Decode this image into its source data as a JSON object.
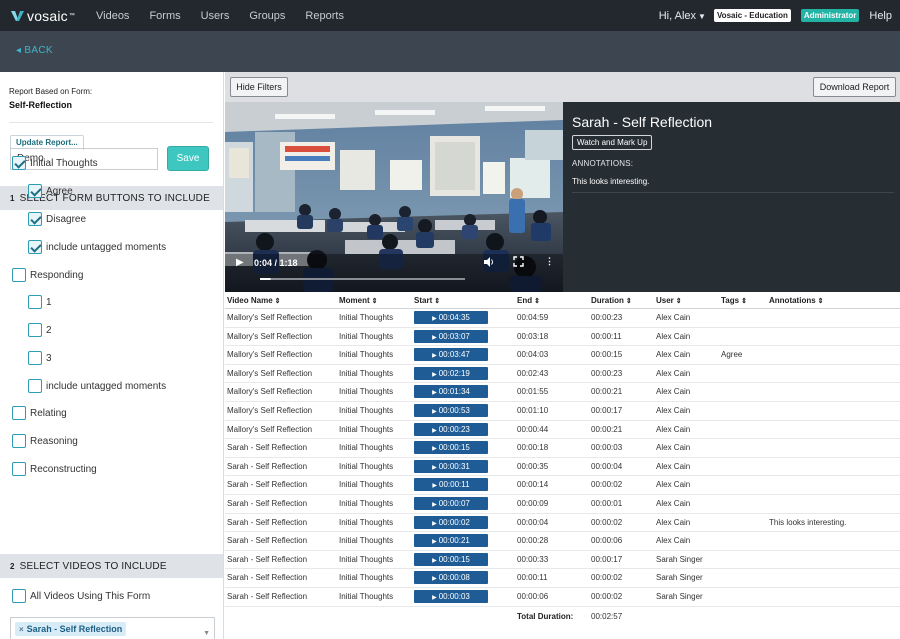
{
  "topnav": {
    "logo_text": "vosaic",
    "logo_tm": "™",
    "items": [
      "Videos",
      "Forms",
      "Users",
      "Groups",
      "Reports"
    ],
    "greeting": "Hi, Alex",
    "org_badge": "Vosaic - Education",
    "role_badge": "Administrator",
    "help": "Help"
  },
  "back_label": "BACK",
  "sidebar": {
    "report_based_label": "Report Based on Form:",
    "form_name": "Self-Reflection",
    "update_label": "Update Report...",
    "report_name_value": "Demo",
    "save_label": "Save",
    "section1": {
      "num": "1",
      "title": "SELECT FORM BUTTONS TO INCLUDE"
    },
    "buttons": [
      {
        "label": "Initial Thoughts",
        "checked": true,
        "level": 0
      },
      {
        "label": "Agree",
        "checked": true,
        "level": 1
      },
      {
        "label": "Disagree",
        "checked": true,
        "level": 1
      },
      {
        "label": "include untagged moments",
        "checked": true,
        "level": 1
      },
      {
        "label": "Responding",
        "checked": false,
        "level": 0
      },
      {
        "label": "1",
        "checked": false,
        "level": 1
      },
      {
        "label": "2",
        "checked": false,
        "level": 1
      },
      {
        "label": "3",
        "checked": false,
        "level": 1
      },
      {
        "label": "include untagged moments",
        "checked": false,
        "level": 1
      },
      {
        "label": "Relating",
        "checked": false,
        "level": 0
      },
      {
        "label": "Reasoning",
        "checked": false,
        "level": 0
      },
      {
        "label": "Reconstructing",
        "checked": false,
        "level": 0
      }
    ],
    "section2": {
      "num": "2",
      "title": "SELECT VIDEOS TO INCLUDE"
    },
    "all_videos_label": "All Videos Using This Form",
    "selected_video_tag": "Sarah - Self Reflection",
    "tag_remove": "×"
  },
  "toolbar": {
    "hide_filters": "Hide Filters",
    "download_report": "Download Report"
  },
  "player": {
    "time": "0:04 / 1:18",
    "progress": 0.051
  },
  "info_panel": {
    "title": "Sarah - Self Reflection",
    "watch_button": "Watch and Mark Up",
    "annotations_label": "ANNOTATIONS:",
    "annotation_text": "This looks interesting."
  },
  "table": {
    "sort_icon": "⇕",
    "columns": [
      "Video Name",
      "Moment",
      "Start",
      "End",
      "Duration",
      "User",
      "Tags",
      "Annotations"
    ],
    "rows": [
      {
        "video": "Mallory's Self Reflection",
        "moment": "Initial Thoughts",
        "start": "00:04:35",
        "end": "00:04:59",
        "duration": "00:00:23",
        "user": "Alex Cain",
        "tags": "",
        "annotations": ""
      },
      {
        "video": "Mallory's Self Reflection",
        "moment": "Initial Thoughts",
        "start": "00:03:07",
        "end": "00:03:18",
        "duration": "00:00:11",
        "user": "Alex Cain",
        "tags": "",
        "annotations": ""
      },
      {
        "video": "Mallory's Self Reflection",
        "moment": "Initial Thoughts",
        "start": "00:03:47",
        "end": "00:04:03",
        "duration": "00:00:15",
        "user": "Alex Cain",
        "tags": "Agree",
        "annotations": ""
      },
      {
        "video": "Mallory's Self Reflection",
        "moment": "Initial Thoughts",
        "start": "00:02:19",
        "end": "00:02:43",
        "duration": "00:00:23",
        "user": "Alex Cain",
        "tags": "",
        "annotations": ""
      },
      {
        "video": "Mallory's Self Reflection",
        "moment": "Initial Thoughts",
        "start": "00:01:34",
        "end": "00:01:55",
        "duration": "00:00:21",
        "user": "Alex Cain",
        "tags": "",
        "annotations": ""
      },
      {
        "video": "Mallory's Self Reflection",
        "moment": "Initial Thoughts",
        "start": "00:00:53",
        "end": "00:01:10",
        "duration": "00:00:17",
        "user": "Alex Cain",
        "tags": "",
        "annotations": ""
      },
      {
        "video": "Mallory's Self Reflection",
        "moment": "Initial Thoughts",
        "start": "00:00:23",
        "end": "00:00:44",
        "duration": "00:00:21",
        "user": "Alex Cain",
        "tags": "",
        "annotations": ""
      },
      {
        "video": "Sarah - Self Reflection",
        "moment": "Initial Thoughts",
        "start": "00:00:15",
        "end": "00:00:18",
        "duration": "00:00:03",
        "user": "Alex Cain",
        "tags": "",
        "annotations": ""
      },
      {
        "video": "Sarah - Self Reflection",
        "moment": "Initial Thoughts",
        "start": "00:00:31",
        "end": "00:00:35",
        "duration": "00:00:04",
        "user": "Alex Cain",
        "tags": "",
        "annotations": ""
      },
      {
        "video": "Sarah - Self Reflection",
        "moment": "Initial Thoughts",
        "start": "00:00:11",
        "end": "00:00:14",
        "duration": "00:00:02",
        "user": "Alex Cain",
        "tags": "",
        "annotations": ""
      },
      {
        "video": "Sarah - Self Reflection",
        "moment": "Initial Thoughts",
        "start": "00:00:07",
        "end": "00:00:09",
        "duration": "00:00:01",
        "user": "Alex Cain",
        "tags": "",
        "annotations": ""
      },
      {
        "video": "Sarah - Self Reflection",
        "moment": "Initial Thoughts",
        "start": "00:00:02",
        "end": "00:00:04",
        "duration": "00:00:02",
        "user": "Alex Cain",
        "tags": "",
        "annotations": "This looks interesting."
      },
      {
        "video": "Sarah - Self Reflection",
        "moment": "Initial Thoughts",
        "start": "00:00:21",
        "end": "00:00:28",
        "duration": "00:00:06",
        "user": "Alex Cain",
        "tags": "",
        "annotations": ""
      },
      {
        "video": "Sarah - Self Reflection",
        "moment": "Initial Thoughts",
        "start": "00:00:15",
        "end": "00:00:33",
        "duration": "00:00:17",
        "user": "Sarah Singer",
        "tags": "",
        "annotations": ""
      },
      {
        "video": "Sarah - Self Reflection",
        "moment": "Initial Thoughts",
        "start": "00:00:08",
        "end": "00:00:11",
        "duration": "00:00:02",
        "user": "Sarah Singer",
        "tags": "",
        "annotations": ""
      },
      {
        "video": "Sarah - Self Reflection",
        "moment": "Initial Thoughts",
        "start": "00:00:03",
        "end": "00:00:06",
        "duration": "00:00:02",
        "user": "Sarah Singer",
        "tags": "",
        "annotations": ""
      }
    ],
    "total_label": "Total Duration:",
    "total_value": "00:02:57"
  },
  "colors": {
    "nav_bg": "#23282e",
    "subbar_bg": "#3d4650",
    "accent_teal": "#3ec7c0",
    "start_button": "#1f5c95",
    "checkbox_border": "#2c9bb3"
  }
}
